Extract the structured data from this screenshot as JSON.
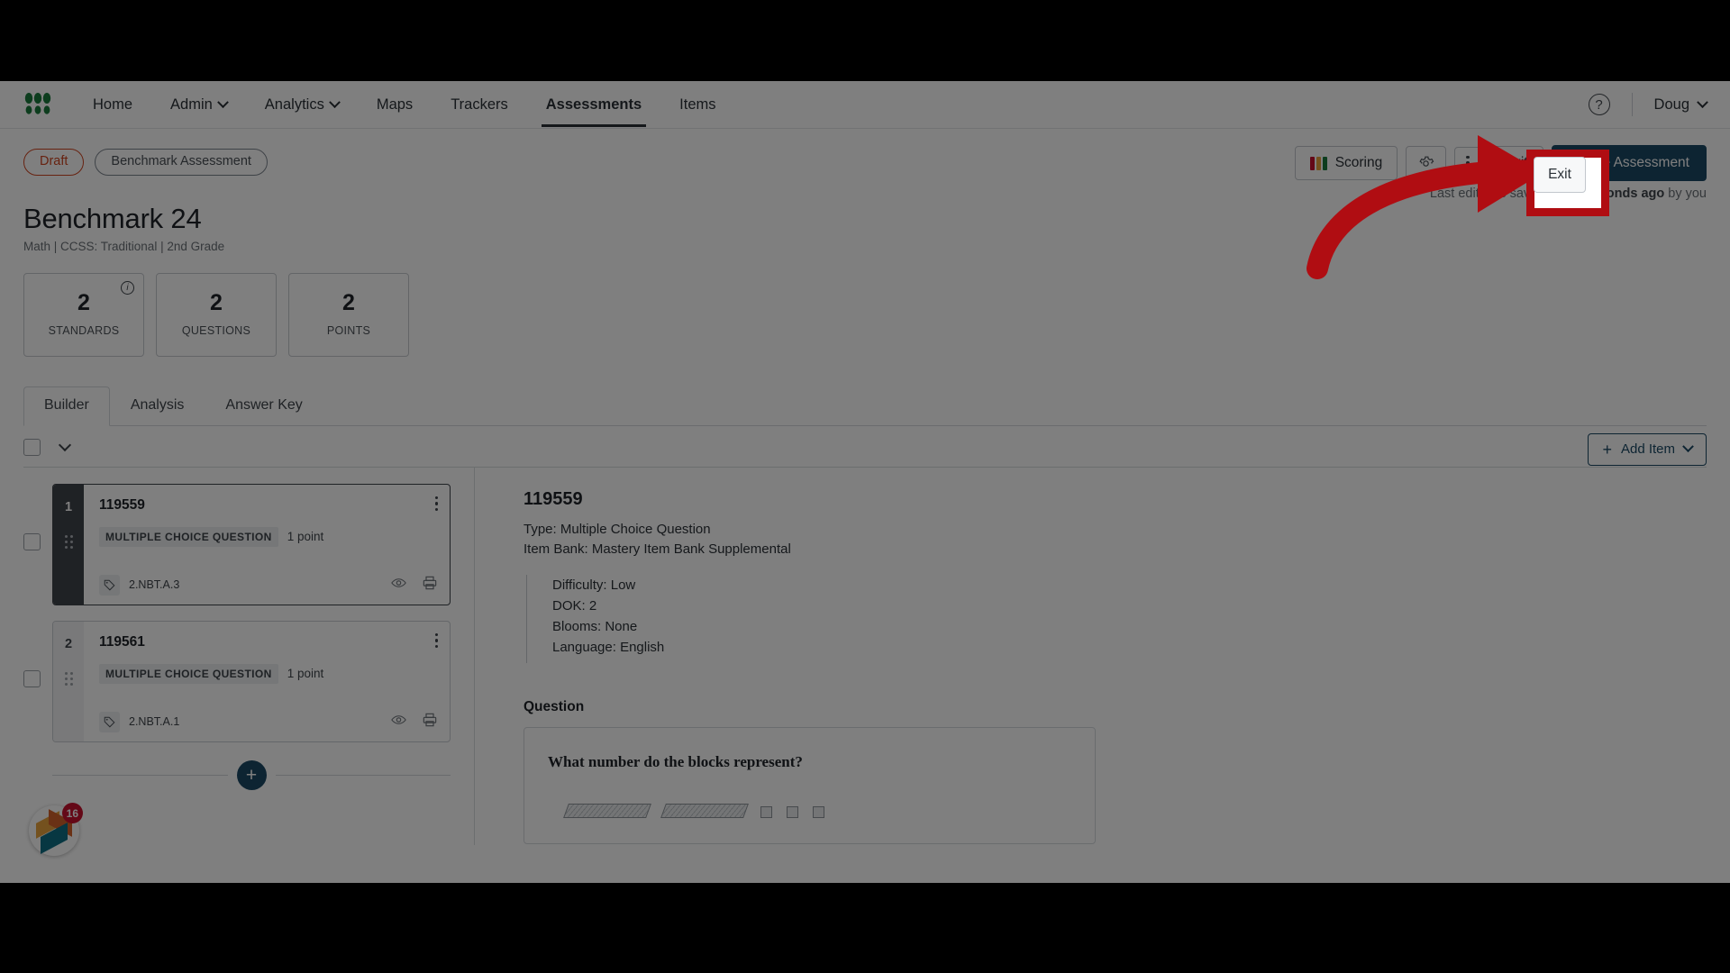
{
  "nav": {
    "logo": "mastery-logo",
    "links": [
      {
        "label": "Home",
        "has_caret": false,
        "active": false
      },
      {
        "label": "Admin",
        "has_caret": true,
        "active": false
      },
      {
        "label": "Analytics",
        "has_caret": true,
        "active": false
      },
      {
        "label": "Maps",
        "has_caret": false,
        "active": false
      },
      {
        "label": "Trackers",
        "has_caret": false,
        "active": false
      },
      {
        "label": "Assessments",
        "has_caret": false,
        "active": true
      },
      {
        "label": "Items",
        "has_caret": false,
        "active": false
      }
    ],
    "help_label": "?",
    "user_name": "Doug"
  },
  "header": {
    "status_pill": "Draft",
    "type_pill": "Benchmark Assessment",
    "title": "Benchmark 24",
    "subtitle": "Math  |  CCSS: Traditional  |  2nd Grade",
    "saved_prefix": "Last edit was saved ",
    "saved_strong": "a few seconds ago",
    "saved_suffix": " by you"
  },
  "actions": {
    "scoring_label": "Scoring",
    "settings_icon": "gear-icon",
    "more_icon": "kebab-icon",
    "exit_label": "Exit",
    "create_label": "Create Assessment",
    "scoring_colors": [
      "#c8102e",
      "#e8a33d",
      "#1a7a3c"
    ],
    "primary_color": "#1b4965"
  },
  "stats": [
    {
      "value": "2",
      "label": "STANDARDS",
      "info": true
    },
    {
      "value": "2",
      "label": "QUESTIONS",
      "info": false
    },
    {
      "value": "2",
      "label": "POINTS",
      "info": false
    }
  ],
  "tabs": [
    {
      "label": "Builder",
      "active": true
    },
    {
      "label": "Analysis",
      "active": false
    },
    {
      "label": "Answer Key",
      "active": false
    }
  ],
  "toolbar": {
    "add_item_label": "Add Item",
    "plus": "+"
  },
  "items": [
    {
      "index": "1",
      "id": "119559",
      "type": "MULTIPLE CHOICE QUESTION",
      "points": "1 point",
      "standard": "2.NBT.A.3",
      "selected": true
    },
    {
      "index": "2",
      "id": "119561",
      "type": "MULTIPLE CHOICE QUESTION",
      "points": "1 point",
      "standard": "2.NBT.A.1",
      "selected": false
    }
  ],
  "detail": {
    "id": "119559",
    "type_line": "Type: Multiple Choice Question",
    "bank_line": "Item Bank: Mastery Item Bank Supplemental",
    "difficulty": "Difficulty: Low",
    "dok": "DOK: 2",
    "blooms": "Blooms: None",
    "language": "Language: English",
    "question_heading": "Question",
    "question_text": "What number do the blocks represent?"
  },
  "fab": {
    "badge_count": "16",
    "name": "help-widget"
  },
  "annotation": {
    "highlight_target": "Exit",
    "arrow_color": "#b00d12",
    "box_color": "#b00d12"
  }
}
